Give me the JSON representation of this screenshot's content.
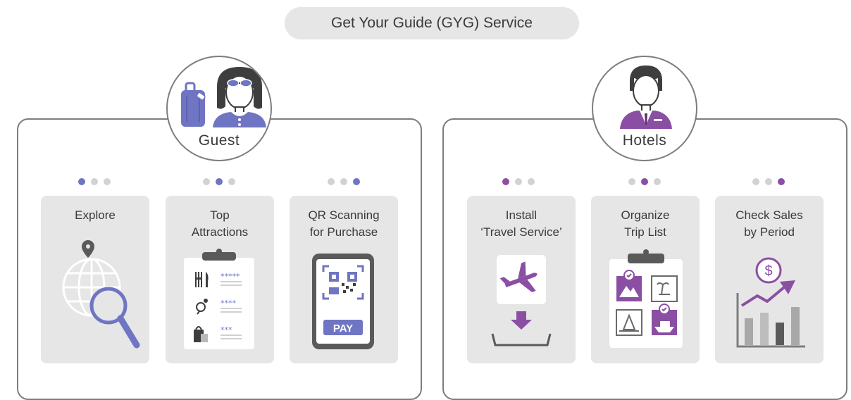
{
  "header": {
    "title": "Get Your Guide (GYG) Service"
  },
  "colors": {
    "guest_accent": "#6f75c2",
    "hotel_accent": "#8a4fa3",
    "neutral": "#7d7d7d"
  },
  "guest": {
    "label": "Guest",
    "cards": [
      {
        "title_lines": [
          "Explore"
        ],
        "step": 1,
        "icon": "globe-search-icon"
      },
      {
        "title_lines": [
          "Top",
          "Attractions"
        ],
        "step": 2,
        "icon": "clipboard-ratings-icon",
        "ratings": [
          "*****",
          "****",
          "***"
        ]
      },
      {
        "title_lines": [
          "QR Scanning",
          "for Purchase"
        ],
        "step": 3,
        "icon": "phone-qr-icon",
        "pay_label": "PAY"
      }
    ]
  },
  "hotels": {
    "label": "Hotels",
    "cards": [
      {
        "title_lines": [
          "Install",
          "‘Travel Service’"
        ],
        "step": 1,
        "icon": "airplane-download-icon"
      },
      {
        "title_lines": [
          "Organize",
          "Trip List"
        ],
        "step": 2,
        "icon": "clipboard-trips-icon"
      },
      {
        "title_lines": [
          "Check Sales",
          "by Period"
        ],
        "step": 3,
        "icon": "sales-chart-icon",
        "currency_symbol": "$"
      }
    ]
  }
}
